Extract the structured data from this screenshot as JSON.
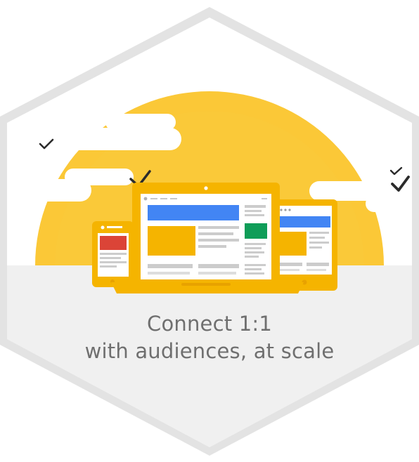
{
  "caption": {
    "line1": "Connect 1:1",
    "line2": "with audiences, at scale"
  },
  "icons": [
    "checkmark-icon",
    "cloud-icon",
    "sun-icon",
    "laptop-icon",
    "tablet-icon",
    "phone-icon"
  ],
  "colors": {
    "hexagon_border": "#e2e2e2",
    "hexagon_fill": "#f1f1f1",
    "sky": "#ffffff",
    "sun": "#fbc837",
    "device_frame": "#f5b400",
    "device_frame_dark": "#e8a200",
    "ad_blue": "#4285f4",
    "ad_green": "#0f9d58",
    "ad_red": "#db4437",
    "placeholder_gray": "#cccccc",
    "caption_text": "#6f6f6f",
    "check": "#2b2b2b"
  }
}
